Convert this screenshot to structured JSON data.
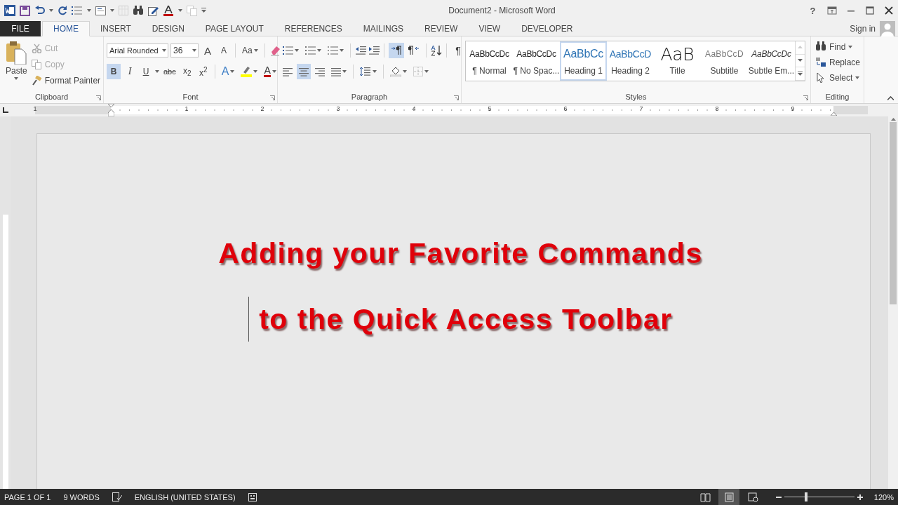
{
  "window": {
    "title": "Document2 - Microsoft Word",
    "help": "?"
  },
  "tabs": [
    {
      "label": "FILE",
      "kind": "file",
      "selected": false
    },
    {
      "label": "HOME",
      "kind": "tab",
      "selected": true
    },
    {
      "label": "INSERT",
      "kind": "tab",
      "selected": false
    },
    {
      "label": "DESIGN",
      "kind": "tab",
      "selected": false
    },
    {
      "label": "PAGE LAYOUT",
      "kind": "tab",
      "selected": false
    },
    {
      "label": "REFERENCES",
      "kind": "tab",
      "selected": false
    },
    {
      "label": "MAILINGS",
      "kind": "tab",
      "selected": false
    },
    {
      "label": "REVIEW",
      "kind": "tab",
      "selected": false
    },
    {
      "label": "VIEW",
      "kind": "tab",
      "selected": false
    },
    {
      "label": "DEVELOPER",
      "kind": "tab",
      "selected": false
    }
  ],
  "account": {
    "label": "Sign in"
  },
  "clipboard": {
    "paste": "Paste",
    "label": "Clipboard",
    "commands": [
      {
        "kind": "cut",
        "label": "Cut",
        "disabled": true
      },
      {
        "kind": "copy",
        "label": "Copy",
        "disabled": true
      },
      {
        "kind": "painter",
        "label": "Format Painter",
        "disabled": false
      }
    ]
  },
  "font": {
    "name": "Arial Rounded",
    "size": "36",
    "grow": "A",
    "shrink": "A",
    "change_case": "Aa",
    "effects": "A",
    "font_color": "A",
    "label": "Font",
    "format_buttons": [
      {
        "kind": "bold",
        "label": "B",
        "selected": true
      },
      {
        "kind": "italic",
        "label": "I",
        "selected": false
      },
      {
        "kind": "underline",
        "label": "U",
        "selected": false
      },
      {
        "kind": "strike",
        "label": "abc",
        "selected": false
      },
      {
        "kind": "sub",
        "label": "x$_{2}$",
        "selected": false
      },
      {
        "kind": "sup",
        "label": "x$^{2}$",
        "selected": false
      }
    ]
  },
  "paragraph": {
    "label": "Paragraph",
    "show_marks": "¶",
    "direction": [
      {
        "kind": "ltr",
        "selected": true
      },
      {
        "kind": "rtl",
        "selected": false
      }
    ],
    "alignment": [
      {
        "kind": "left",
        "selected": false
      },
      {
        "kind": "center",
        "selected": true
      },
      {
        "kind": "right",
        "selected": false
      },
      {
        "kind": "justify",
        "selected": false
      }
    ]
  },
  "styles": {
    "label": "Styles",
    "items": [
      {
        "kind": "normal",
        "preview": "AaBbCcDc",
        "name": "¶ Normal",
        "selected": false
      },
      {
        "kind": "normal",
        "preview": "AaBbCcDc",
        "name": "¶ No Spac...",
        "selected": false
      },
      {
        "kind": "heading1",
        "preview": "AaBbCc",
        "name": "Heading 1",
        "selected": true
      },
      {
        "kind": "heading2",
        "preview": "AaBbCcD",
        "name": "Heading 2",
        "selected": false
      },
      {
        "kind": "title",
        "preview": "AaB",
        "name": "Title",
        "selected": false
      },
      {
        "kind": "subtitle",
        "preview": "AaBbCcD",
        "name": "Subtitle",
        "selected": false
      },
      {
        "kind": "emphasis",
        "preview": "AaBbCcDc",
        "name": "Subtle Em...",
        "selected": false
      }
    ]
  },
  "editing": {
    "label": "Editing",
    "commands": [
      {
        "kind": "find",
        "label": "Find"
      },
      {
        "kind": "replace",
        "label": "Replace"
      },
      {
        "kind": "select",
        "label": "Select"
      }
    ]
  },
  "ruler": {
    "numbers": [
      "1",
      "1",
      "2",
      "3",
      "4",
      "5",
      "6",
      "7",
      "8",
      "9"
    ]
  },
  "document": {
    "paragraphs": [
      "Adding your Favorite Commands",
      "to the Quick Access Toolbar"
    ]
  },
  "status_bar": {
    "page": "PAGE 1 OF 1",
    "words": "9 WORDS",
    "language": "ENGLISH (UNITED STATES)",
    "views": [
      {
        "kind": "read",
        "selected": false
      },
      {
        "kind": "print",
        "selected": true
      },
      {
        "kind": "web",
        "selected": false
      }
    ],
    "zoom": {
      "level": 0.31,
      "reading": "120%"
    }
  }
}
